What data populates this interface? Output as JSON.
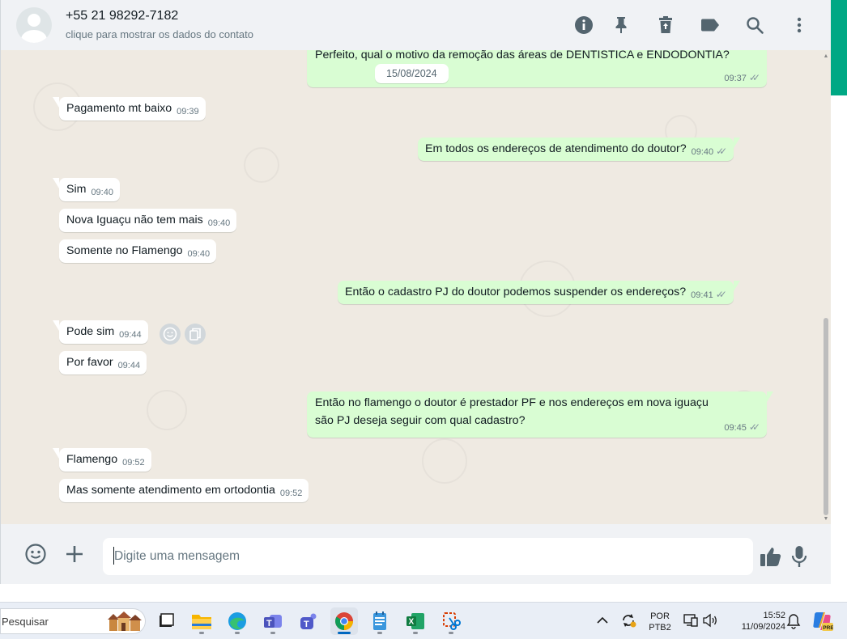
{
  "header": {
    "contact_name": "+55 21 98292-7182",
    "contact_subtitle": "clique para mostrar os dados do contato",
    "icons": [
      "info-icon",
      "pin-icon",
      "delete-icon",
      "label-icon",
      "search-icon",
      "menu-icon"
    ]
  },
  "chat": {
    "top_cut_message": {
      "text": "Perfeito, qual o motivo da remoção das áreas de DENTISTICA e ENDODONTIA?",
      "time": "09:37"
    },
    "date_chip": "15/08/2024",
    "messages": [
      {
        "dir": "in",
        "text": "Pagamento mt baixo",
        "time": "09:39"
      },
      {
        "dir": "out",
        "text": "Em todos os endereços de atendimento do doutor?",
        "time": "09:40"
      },
      {
        "dir": "in",
        "text": "Sim",
        "time": "09:40"
      },
      {
        "dir": "in",
        "text": "Nova Iguaçu não tem mais",
        "time": "09:40"
      },
      {
        "dir": "in",
        "text": "Somente no Flamengo",
        "time": "09:40"
      },
      {
        "dir": "out",
        "text": "Então o cadastro PJ do doutor podemos suspender os endereços?",
        "time": "09:41"
      },
      {
        "dir": "in",
        "text": "Pode sim",
        "time": "09:44"
      },
      {
        "dir": "in",
        "text": "Por favor",
        "time": "09:44"
      },
      {
        "dir": "out",
        "line1": "Então no flamengo o doutor é prestador PF e nos endereços em nova iguaçu",
        "line2": "são PJ deseja seguir com qual cadastro?",
        "time": "09:45"
      },
      {
        "dir": "in",
        "text": "Flamengo",
        "time": "09:52"
      },
      {
        "dir": "in",
        "text": "Mas somente atendimento em ortodontia",
        "time": "09:52"
      }
    ]
  },
  "composer": {
    "placeholder": "Digite uma mensagem",
    "icons": [
      "emoji-icon",
      "attach-icon",
      "thumbs-up-icon",
      "microphone-icon"
    ]
  },
  "taskbar": {
    "search_text": "Pesquisar",
    "lang_line1": "POR",
    "lang_line2": "PTB2",
    "time": "15:52",
    "date": "11/09/2024",
    "apps": [
      "task-view",
      "file-explorer",
      "edge",
      "teams-work",
      "teams",
      "chrome",
      "notepad",
      "excel",
      "snipping-tool"
    ]
  },
  "colors": {
    "accent": "#00a884",
    "chat_bg": "#efeae2",
    "bubble_out": "#d9fdd3",
    "bubble_in": "#ffffff",
    "ticks": "#8696a0"
  }
}
